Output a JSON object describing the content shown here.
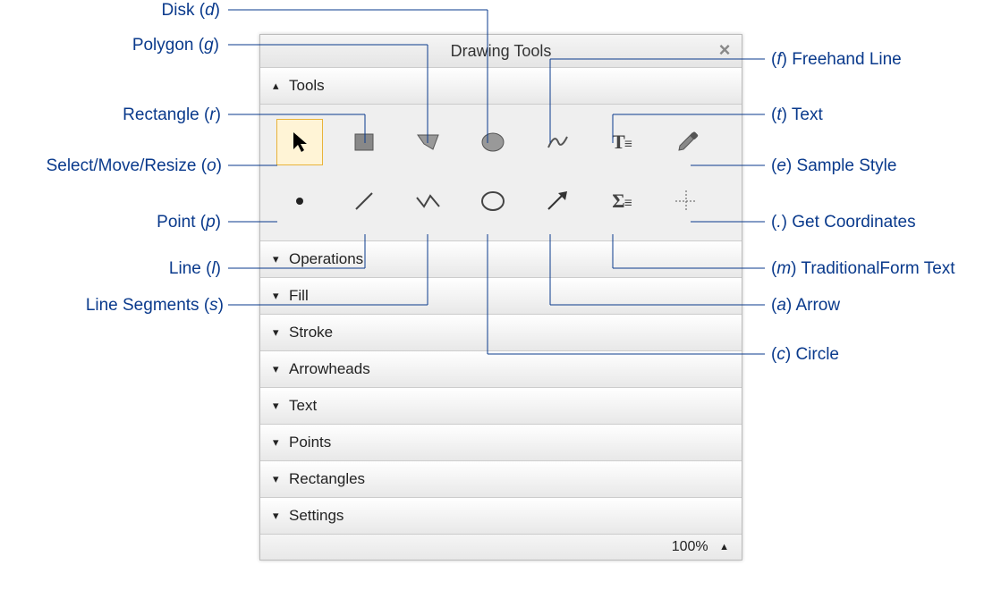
{
  "panel": {
    "title": "Drawing Tools",
    "zoom": "100%"
  },
  "sections": {
    "tools": "Tools",
    "operations": "Operations",
    "fill": "Fill",
    "stroke": "Stroke",
    "arrowheads": "Arrowheads",
    "text": "Text",
    "points": "Points",
    "rectangles": "Rectangles",
    "settings": "Settings"
  },
  "tools_row1": [
    {
      "name": "select",
      "key": "o"
    },
    {
      "name": "rectangle",
      "key": "r"
    },
    {
      "name": "polygon",
      "key": "g"
    },
    {
      "name": "disk",
      "key": "d"
    },
    {
      "name": "freehand",
      "key": "f"
    },
    {
      "name": "text",
      "key": "t"
    },
    {
      "name": "sample-style",
      "key": "e"
    }
  ],
  "tools_row2": [
    {
      "name": "point",
      "key": "p"
    },
    {
      "name": "line",
      "key": "l"
    },
    {
      "name": "line-segments",
      "key": "s"
    },
    {
      "name": "circle",
      "key": "c"
    },
    {
      "name": "arrow",
      "key": "a"
    },
    {
      "name": "traditionalform-text",
      "key": "m"
    },
    {
      "name": "get-coordinates",
      "key": "."
    }
  ],
  "callouts": {
    "disk": {
      "label": "Disk",
      "key": "d"
    },
    "polygon": {
      "label": "Polygon",
      "key": "g"
    },
    "rectangle": {
      "label": "Rectangle",
      "key": "r"
    },
    "select": {
      "label": "Select/Move/Resize",
      "key": "o"
    },
    "point": {
      "label": "Point",
      "key": "p"
    },
    "line": {
      "label": "Line",
      "key": "l"
    },
    "segments": {
      "label": "Line Segments",
      "key": "s"
    },
    "freehand": {
      "label": "Freehand Line",
      "key": "f"
    },
    "text": {
      "label": "Text",
      "key": "t"
    },
    "sample": {
      "label": "Sample Style",
      "key": "e"
    },
    "coords": {
      "label": "Get Coordinates",
      "key": "."
    },
    "tform": {
      "label": "TraditionalForm Text",
      "key": "m"
    },
    "arrow": {
      "label": "Arrow",
      "key": "a"
    },
    "circle": {
      "label": "Circle",
      "key": "c"
    }
  }
}
